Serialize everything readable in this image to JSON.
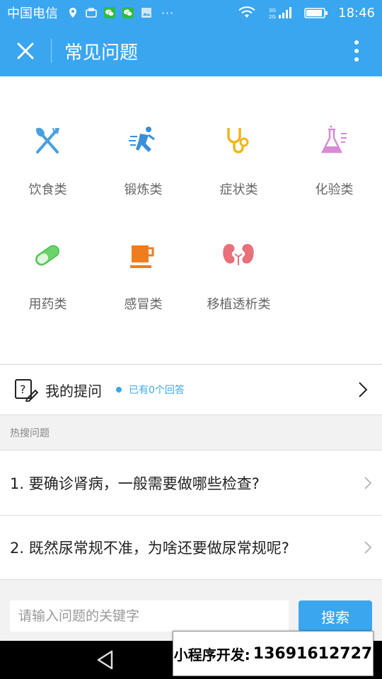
{
  "status_bar": {
    "carrier": "中国电信",
    "time": "18:46",
    "icons": [
      "location-icon",
      "briefcase-icon",
      "wechat-icon",
      "wechat-icon",
      "image-icon"
    ],
    "overflow": "···",
    "network": "3G 2G"
  },
  "title_bar": {
    "title": "常见问题"
  },
  "categories": [
    {
      "label": "饮食类",
      "icon": "fork-knife-icon",
      "color": "#4a9fe0"
    },
    {
      "label": "锻炼类",
      "icon": "runner-icon",
      "color": "#3a8fd8"
    },
    {
      "label": "症状类",
      "icon": "stethoscope-icon",
      "color": "#f1b51c"
    },
    {
      "label": "化验类",
      "icon": "flask-icon",
      "color": "#d88ad6"
    },
    {
      "label": "用药类",
      "icon": "pill-icon",
      "color": "#6ad36a"
    },
    {
      "label": "感冒类",
      "icon": "cup-icon",
      "color": "#f07c1d"
    },
    {
      "label": "移植透析类",
      "icon": "kidney-icon",
      "color": "#e8707a"
    }
  ],
  "my_question": {
    "label": "我的提问",
    "status": "已有0个回答"
  },
  "hot_search": {
    "header": "热搜问题",
    "items": [
      {
        "text": "1. 要确诊肾病，一般需要做哪些检查?"
      },
      {
        "text": "2. 既然尿常规不准，为啥还要做尿常规呢?"
      }
    ]
  },
  "search": {
    "placeholder": "请输入问题的关键字",
    "button": "搜索"
  },
  "promo": {
    "label": "小程序开发:",
    "phone": "13691612727"
  },
  "colors": {
    "accent": "#3aa6f0"
  }
}
